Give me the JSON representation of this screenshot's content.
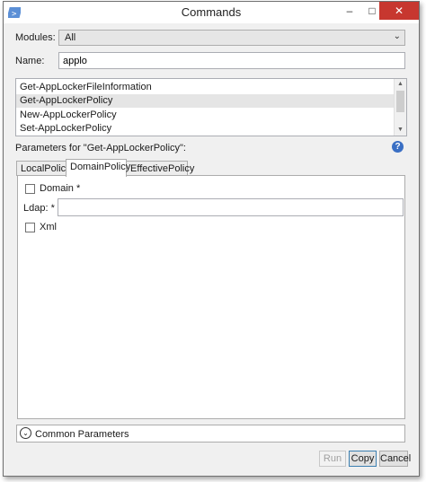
{
  "window": {
    "title": "Commands",
    "app_icon": "powershell-icon"
  },
  "controls": {
    "minimize": "–",
    "maximize": "□",
    "close": "✕"
  },
  "modules": {
    "label": "Modules:",
    "value": "All",
    "arrow": "⌄"
  },
  "name": {
    "label": "Name:",
    "value": "applo"
  },
  "commands": [
    {
      "label": "Get-AppLockerFileInformation",
      "selected": false
    },
    {
      "label": "Get-AppLockerPolicy",
      "selected": true
    },
    {
      "label": "New-AppLockerPolicy",
      "selected": false
    },
    {
      "label": "Set-AppLockerPolicy",
      "selected": false
    }
  ],
  "params_header": "Parameters for \"Get-AppLockerPolicy\":",
  "help": "?",
  "tabs": [
    {
      "label": "LocalPolicy",
      "active": false
    },
    {
      "label": "DomainPolicy",
      "active": true
    },
    {
      "label": "EffectivePolicy",
      "active": false
    }
  ],
  "fields": {
    "domain_label": "Domain *",
    "domain_checked": false,
    "ldap_label": "Ldap: *",
    "ldap_value": "",
    "xml_label": "Xml",
    "xml_checked": false
  },
  "common_parameters": "Common Parameters",
  "buttons": {
    "run": "Run",
    "copy": "Copy",
    "cancel": "Cancel"
  },
  "colors": {
    "close": "#c7372f",
    "help": "#3a6fc4",
    "selected_row": "#e5e5e5"
  }
}
